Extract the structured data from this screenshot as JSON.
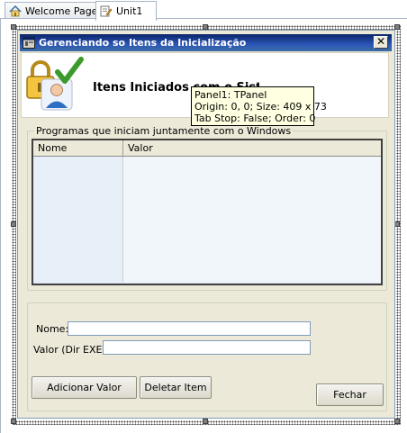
{
  "ide": {
    "tabs": [
      {
        "label": "Welcome Page",
        "icon": "home-icon"
      },
      {
        "label": "Unit1",
        "icon": "unit-file-icon"
      }
    ]
  },
  "form": {
    "title": "Gerenciando so Itens da Inicialização",
    "close_glyph": "✕",
    "header": {
      "title": "Itens Iniciados com o Sist",
      "icon": "lock-user-check-icon"
    },
    "hint": {
      "line1": "Panel1: TPanel",
      "line2": "Origin: 0, 0; Size: 409 x 73",
      "line3": "Tab Stop: False; Order: 0"
    },
    "programs_group": {
      "caption": "Programas que iniciam juntamente com o Windows",
      "columns": [
        "Nome",
        "Valor"
      ],
      "rows": [
        "",
        "",
        "",
        "",
        "",
        "",
        "",
        "",
        "",
        ""
      ]
    },
    "edit_group": {
      "name_label": "Nome:",
      "name_value": "",
      "value_label": "Valor (Dir EXE)",
      "value_value": "",
      "add_button": "Adicionar Valor",
      "delete_button": "Deletar Item",
      "close_button": "Fechar"
    }
  },
  "colors": {
    "titlebar": "#0a246a",
    "form_background": "#ece9d8",
    "hint_background": "#ffffe1",
    "grid_row_left": "#e7eff8"
  }
}
